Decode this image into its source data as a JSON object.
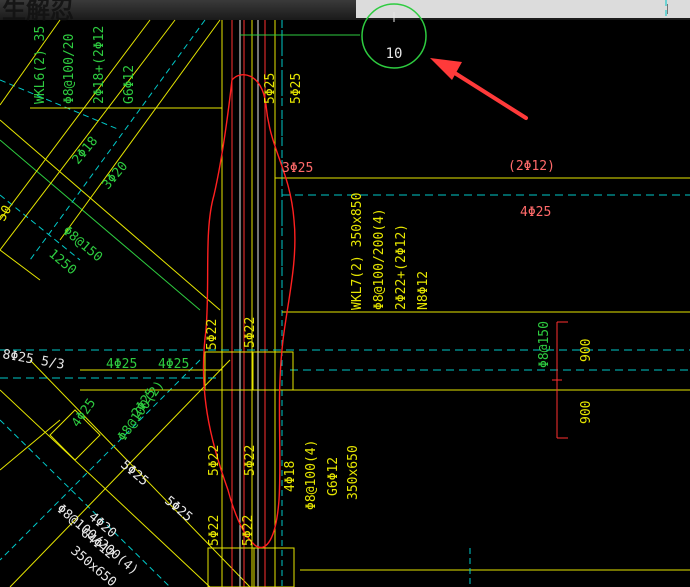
{
  "window": {
    "title": "生解忍"
  },
  "colors": {
    "background": "#000000",
    "yellow": "#e6e600",
    "green": "#2ecc40",
    "cyan": "#00c8c8",
    "red": "#ff3030",
    "redtext": "#ff6a6a",
    "white": "#e8e8e8",
    "callout": "#2ecc40",
    "arrow": "#ff3a3a"
  },
  "callout": {
    "number": "10"
  },
  "labels": {
    "wkl6_name": "WKL6(2) 35",
    "wkl6_stirrup": "Φ8@100/20",
    "wkl6_top": "2Φ18+(2Φ12",
    "wkl6_g": "G6Φ12",
    "v1": "5Φ25",
    "v2": "5Φ25",
    "d1": "2Φ18",
    "d2": "3Φ20",
    "d3": "Φ8@150",
    "d4": "1250",
    "d5": "50",
    "top1": "3Φ25",
    "right_top": "(2Φ12)",
    "right_mid": "4Φ25",
    "wkl7_name": "WKL7(2) 350x850",
    "wkl7_stirrup": "Φ8@100/200(4)",
    "wkl7_top": "2Φ22+(2Φ12)",
    "wkl7_n": "N8Φ12",
    "col1": "5Φ22",
    "col2": "5Φ22",
    "col3": "5Φ22",
    "col4": "5Φ22",
    "col5": "5Φ22",
    "col6": "5Φ22",
    "left1": "8Φ25 5/3",
    "left2": "4Φ25",
    "left3": "4Φ25",
    "dia1": "4Φ25",
    "dia2": "2Φ25",
    "dia3": "Φ8@100(2)",
    "dia4": "5Φ25",
    "dia5": "5Φ25",
    "low1": "Φ8@100/200(4)",
    "low2": "4Φ20",
    "low3": "G4Φ12",
    "low4": "350x650",
    "mid_beam1": "4Φ18",
    "mid_beam2": "Φ8@100(4)",
    "mid_beam3": "G6Φ12",
    "mid_beam4": "350x650",
    "r_stir": "Φ8@150",
    "dim1": "900",
    "dim2": "900"
  }
}
